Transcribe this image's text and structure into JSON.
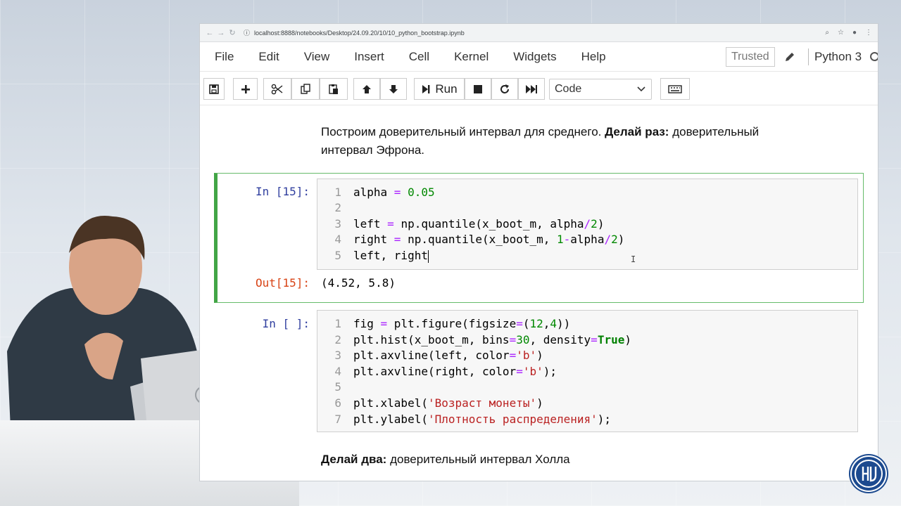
{
  "browser": {
    "url": "localhost:8888/notebooks/Desktop/24.09.20/10/10_python_bootstrap.ipynb"
  },
  "menu": [
    "File",
    "Edit",
    "View",
    "Insert",
    "Cell",
    "Kernel",
    "Widgets",
    "Help"
  ],
  "status": {
    "trusted": "Trusted",
    "kernel": "Python 3"
  },
  "toolbar": {
    "run_label": "Run",
    "cell_type": "Code"
  },
  "markdown": {
    "intro_prefix": "Построим доверительный интервал для среднего. ",
    "intro_bold": "Делай раз:",
    "intro_suffix": " доверительный",
    "intro_line2": "интервал Эфрона.",
    "hall_bold": "Делай два:",
    "hall_suffix": " доверительный интервал Холла"
  },
  "cells": [
    {
      "prompt_in": "In [15]:",
      "prompt_out": "Out[15]:",
      "output": "(4.52, 5.8)",
      "line_numbers": [
        "1",
        "2",
        "3",
        "4",
        "5"
      ]
    },
    {
      "prompt_in": "In [ ]:",
      "line_numbers": [
        "1",
        "2",
        "3",
        "4",
        "5",
        "6",
        "7"
      ]
    }
  ],
  "colors": {
    "selected_cell_border": "#42a546",
    "prompt_in": "#303f9f",
    "prompt_out": "#d84315"
  }
}
